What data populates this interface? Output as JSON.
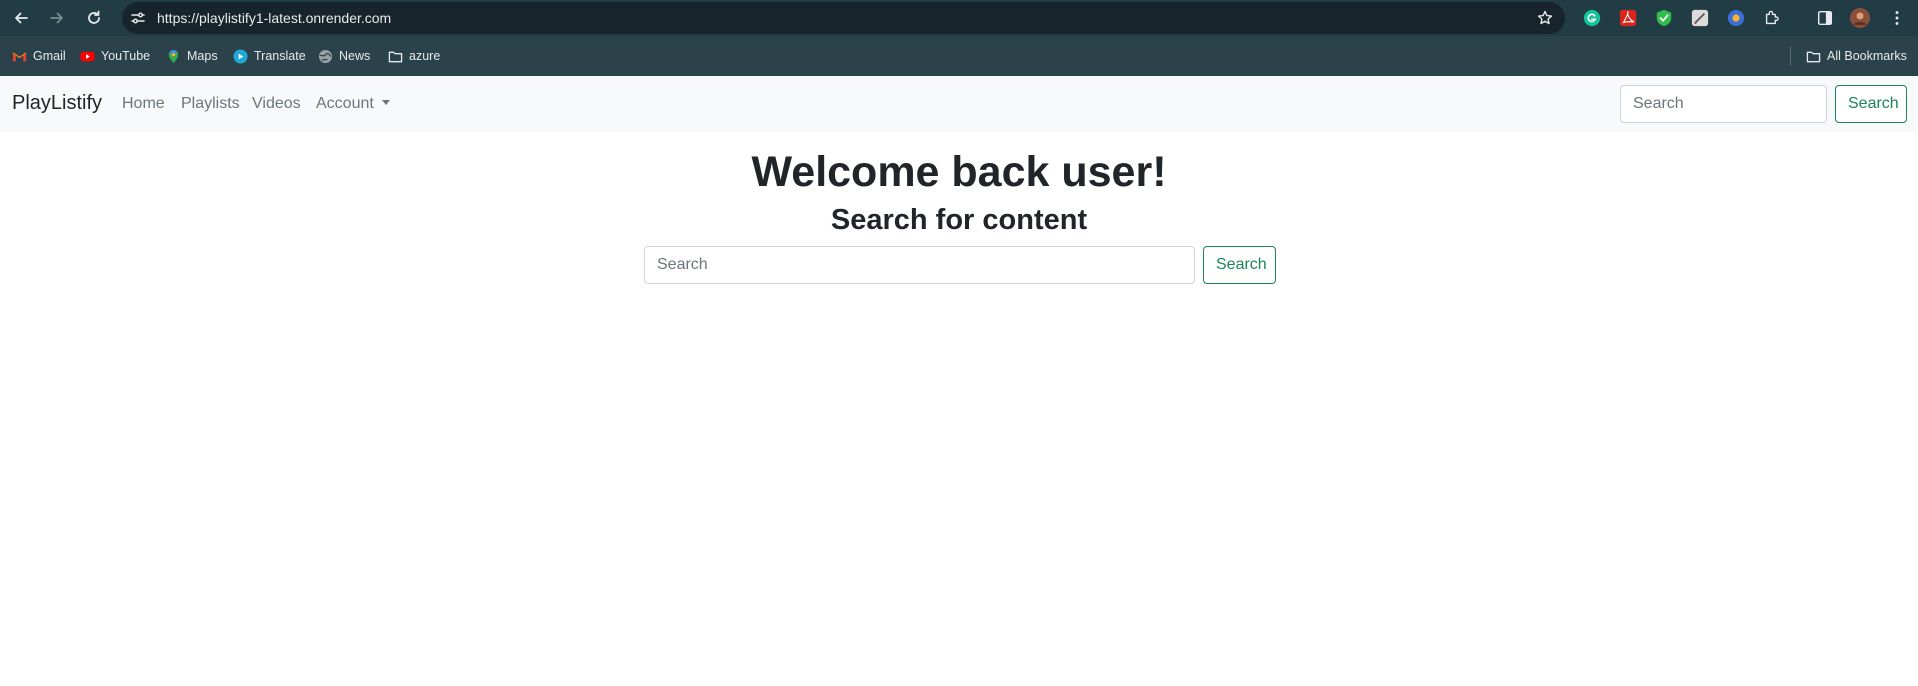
{
  "browser": {
    "url": "https://playlistify1-latest.onrender.com",
    "bookmarks": [
      {
        "label": "Gmail",
        "icon": "gmail-icon"
      },
      {
        "label": "YouTube",
        "icon": "youtube-icon"
      },
      {
        "label": "Maps",
        "icon": "maps-icon"
      },
      {
        "label": "Translate",
        "icon": "translate-icon"
      },
      {
        "label": "News",
        "icon": "news-icon"
      },
      {
        "label": "azure",
        "icon": "folder-icon"
      }
    ],
    "all_bookmarks": "All Bookmarks"
  },
  "app": {
    "brand": "PlayListify",
    "nav": {
      "home": "Home",
      "playlists": "Playlists",
      "videos": "Videos",
      "account": "Account"
    },
    "navbar_search": {
      "placeholder": "Search",
      "button": "Search"
    }
  },
  "main": {
    "title": "Welcome back user!",
    "subtitle": "Search for content",
    "search": {
      "placeholder": "Search",
      "button": "Search"
    }
  },
  "colors": {
    "chrome_dark": "#223c46",
    "bookmarks_bar": "#2c424b",
    "navbar_bg": "#f8f9fa",
    "success": "#198754",
    "text": "#212529",
    "muted": "#6c757d"
  }
}
